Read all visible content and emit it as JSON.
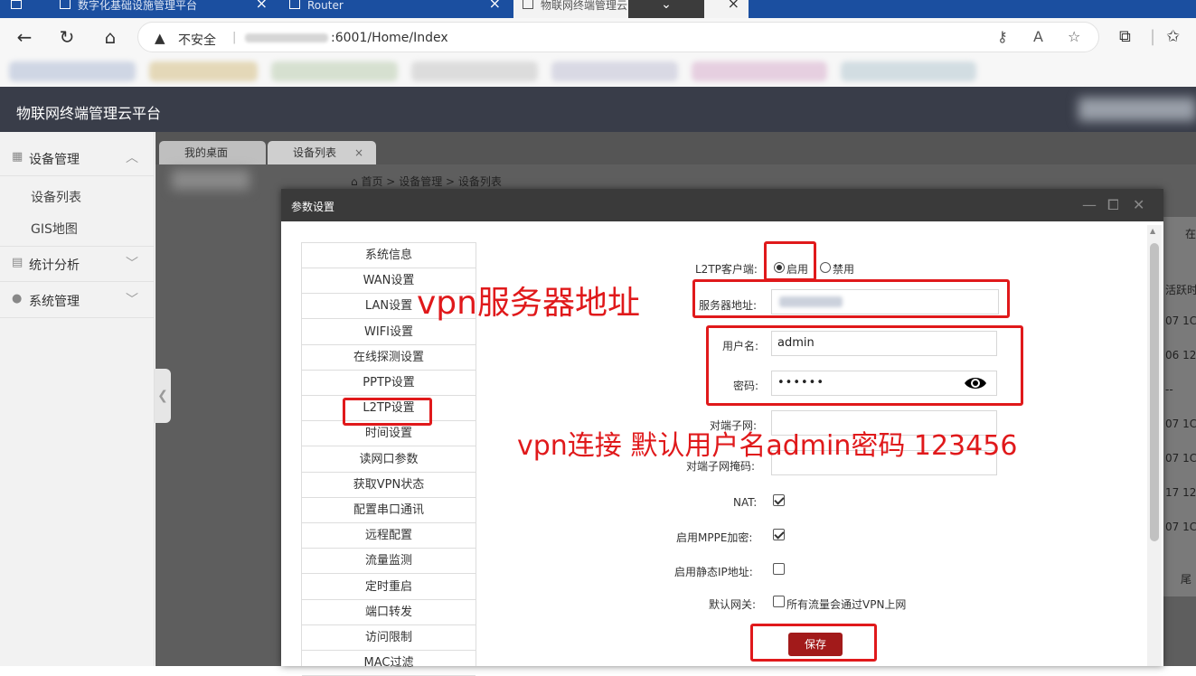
{
  "browser": {
    "tabs": [
      {
        "title": "数字化基础设施管理平台"
      },
      {
        "title": "Router"
      },
      {
        "title": "物联网终端管理云"
      }
    ],
    "tab_dropdown_glyph": "⌄",
    "security_warning": "不安全",
    "url_suffix": ":6001/Home/Index"
  },
  "app": {
    "title": "物联网终端管理云平台"
  },
  "sidebar": {
    "groups": [
      {
        "label": "设备管理",
        "icon": "device-icon",
        "items": [
          "设备列表",
          "GIS地图"
        ]
      },
      {
        "label": "统计分析",
        "icon": "chart-icon"
      },
      {
        "label": "系统管理",
        "icon": "user-icon"
      }
    ]
  },
  "page_tabs": [
    {
      "label": "我的桌面"
    },
    {
      "label": "设备列表",
      "close": "×"
    }
  ],
  "breadcrumb": {
    "home": "首页",
    "sep": ">",
    "level1": "设备管理",
    "level2": "设备列表"
  },
  "background_table": {
    "header_fragment": "在",
    "col_header_fragment": "活跃时",
    "rows": [
      "07 1C",
      "06 12",
      "--",
      "07 1C",
      "07 1C",
      "17 12",
      "07 1C"
    ],
    "button_fragment": "尾"
  },
  "modal": {
    "title": "参数设置",
    "menu": [
      "系统信息",
      "WAN设置",
      "LAN设置",
      "WIFI设置",
      "在线探测设置",
      "PPTP设置",
      "L2TP设置",
      "时间设置",
      "读网口参数",
      "获取VPN状态",
      "配置串口通讯",
      "远程配置",
      "流量监测",
      "定时重启",
      "端口转发",
      "访问限制",
      "MAC过滤"
    ],
    "form": {
      "l2tp_client_label": "L2TP客户端:",
      "enable_label": "启用",
      "disable_label": "禁用",
      "server_label": "服务器地址:",
      "username_label": "用户名:",
      "username_value": "admin",
      "password_label": "密码:",
      "password_value": "••••••",
      "peer_subnet_label": "对端子网:",
      "peer_mask_label": "对端子网掩码:",
      "nat_label": "NAT:",
      "mppe_label": "启用MPPE加密:",
      "static_ip_label": "启用静态IP地址:",
      "gateway_label": "默认网关:",
      "gateway_text": "所有流量会通过VPN上网",
      "save_label": "保存"
    }
  },
  "annotations": {
    "server_note": "vpn服务器地址",
    "login_note": "vpn连接 默认用户名admin密码 123456",
    "color": "#e0191b"
  }
}
